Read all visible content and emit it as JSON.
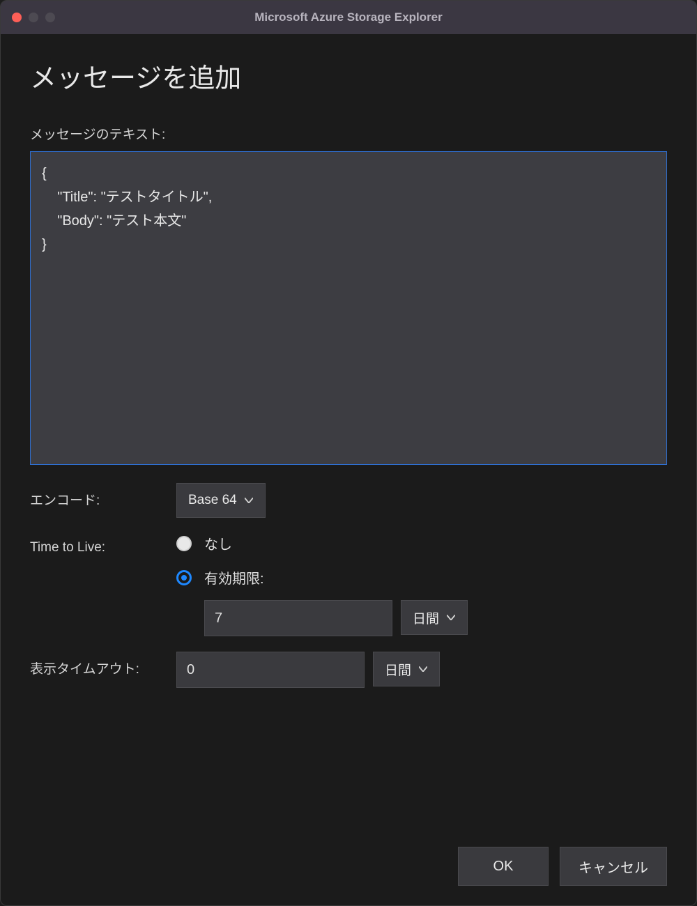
{
  "window": {
    "title": "Microsoft Azure Storage Explorer"
  },
  "dialog": {
    "heading": "メッセージを追加",
    "message_text_label": "メッセージのテキスト:",
    "message_text_value": "{\n    \"Title\": \"テストタイトル\",\n    \"Body\": \"テスト本文\"\n}",
    "encoding": {
      "label": "エンコード:",
      "value": "Base 64"
    },
    "ttl": {
      "label": "Time to Live:",
      "options": {
        "none": "なし",
        "expires": "有効期限:"
      },
      "selected": "expires",
      "value": "7",
      "unit": "日間"
    },
    "visibility_timeout": {
      "label": "表示タイムアウト:",
      "value": "0",
      "unit": "日間"
    },
    "buttons": {
      "ok": "OK",
      "cancel": "キャンセル"
    }
  }
}
